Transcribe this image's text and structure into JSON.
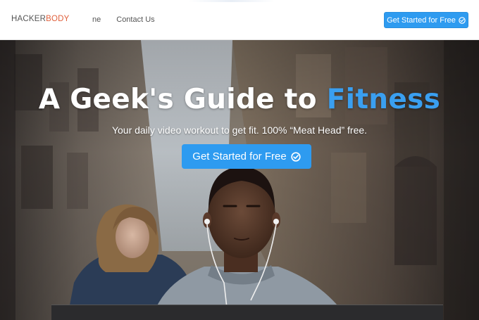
{
  "brand": {
    "part1": "HACKER",
    "part2": "BODY"
  },
  "nav": {
    "items": [
      {
        "label": "ne"
      },
      {
        "label": "Contact Us"
      }
    ]
  },
  "header": {
    "cta_label": "Get Started for Free"
  },
  "hero": {
    "title_main": "A Geek's Guide to ",
    "title_accent": "Fitness",
    "subtitle": "Your daily video workout to get fit. 100% “Meat Head” free.",
    "cta_label": "Get Started for Free"
  },
  "colors": {
    "accent": "#2e9bf0",
    "brand_orange": "#e0603c",
    "title_accent": "#3a9ff0"
  },
  "icons": {
    "cta": "check-circle-icon"
  }
}
